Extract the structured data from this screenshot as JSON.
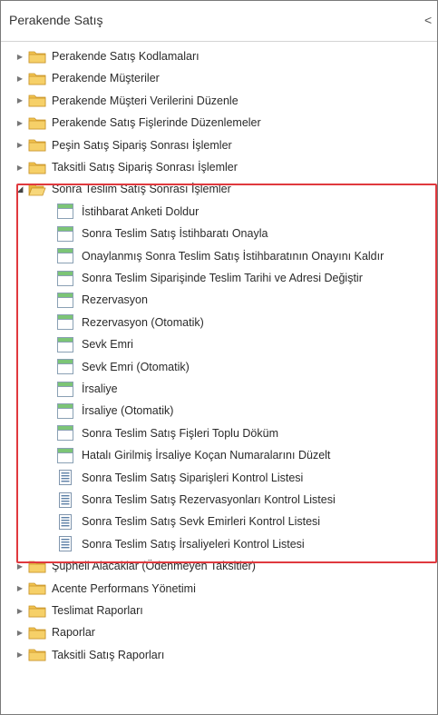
{
  "panel": {
    "title": "Perakende Satış",
    "collapse_glyph": "<"
  },
  "tree": [
    {
      "label": "Perakende Satış Kodlamaları",
      "type": "folder",
      "expanded": false
    },
    {
      "label": "Perakende Müşteriler",
      "type": "folder",
      "expanded": false
    },
    {
      "label": "Perakende Müşteri Verilerini Düzenle",
      "type": "folder",
      "expanded": false
    },
    {
      "label": "Perakende Satış Fişlerinde Düzenlemeler",
      "type": "folder",
      "expanded": false
    },
    {
      "label": "Peşin Satış Sipariş Sonrası İşlemler",
      "type": "folder",
      "expanded": false
    },
    {
      "label": "Taksitli Satış Sipariş Sonrası İşlemler",
      "type": "folder",
      "expanded": false
    },
    {
      "label": "Sonra Teslim Satış Sonrası İşlemler",
      "type": "folder",
      "expanded": true,
      "selected": true,
      "children": [
        {
          "label": "İstihbarat Anketi Doldur",
          "icon": "form-icon"
        },
        {
          "label": "Sonra Teslim Satış İstihbaratı Onayla",
          "icon": "form-icon"
        },
        {
          "label": "Onaylanmış Sonra Teslim Satış İstihbaratının Onayını Kaldır",
          "icon": "form-icon"
        },
        {
          "label": "Sonra Teslim Siparişinde Teslim Tarihi ve Adresi Değiştir",
          "icon": "form-icon"
        },
        {
          "label": "Rezervasyon",
          "icon": "form-icon"
        },
        {
          "label": "Rezervasyon (Otomatik)",
          "icon": "form-icon"
        },
        {
          "label": "Sevk Emri",
          "icon": "form-icon"
        },
        {
          "label": "Sevk Emri (Otomatik)",
          "icon": "form-icon"
        },
        {
          "label": "İrsaliye",
          "icon": "form-icon"
        },
        {
          "label": "İrsaliye (Otomatik)",
          "icon": "form-icon"
        },
        {
          "label": "Sonra Teslim Satış Fişleri Toplu Döküm",
          "icon": "form-icon"
        },
        {
          "label": "Hatalı Girilmiş İrsaliye Koçan Numaralarını Düzelt",
          "icon": "form-icon"
        },
        {
          "label": "Sonra Teslim Satış Siparişleri Kontrol Listesi",
          "icon": "report-icon"
        },
        {
          "label": "Sonra Teslim Satış Rezervasyonları Kontrol Listesi",
          "icon": "report-icon"
        },
        {
          "label": "Sonra Teslim Satış Sevk Emirleri Kontrol Listesi",
          "icon": "report-icon"
        },
        {
          "label": "Sonra Teslim Satış İrsaliyeleri Kontrol Listesi",
          "icon": "report-icon"
        }
      ]
    },
    {
      "label": "Şüpheli Alacaklar (Ödenmeyen Taksitler)",
      "type": "folder",
      "expanded": false
    },
    {
      "label": "Acente Performans Yönetimi",
      "type": "folder",
      "expanded": false
    },
    {
      "label": "Teslimat Raporları",
      "type": "folder",
      "expanded": false
    },
    {
      "label": "Raporlar",
      "type": "folder",
      "expanded": false
    },
    {
      "label": "Taksitli Satış Raporları",
      "type": "folder",
      "expanded": false
    }
  ],
  "colors": {
    "highlight_border": "#e0393e",
    "folder": "#f2c34f",
    "form_icon_header": "#7cc576"
  }
}
